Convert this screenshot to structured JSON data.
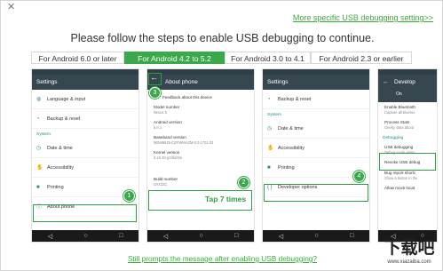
{
  "dialog": {
    "close_glyph": "✕",
    "top_link": "More specific USB debugging setting>>",
    "heading": "Please follow the steps to enable USB debugging to continue.",
    "bottom_link": "Still prompts the message after enabling USB debugging?"
  },
  "tabs": [
    {
      "label": "For Android 6.0 or later"
    },
    {
      "label": "For Android 4.2 to 5.2"
    },
    {
      "label": "For Android 3.0 to 4.1"
    },
    {
      "label": "For Android 2.3 or earlier"
    }
  ],
  "phone1": {
    "title": "Settings",
    "items": [
      {
        "label": "Language & input",
        "icon": "globe-icon"
      },
      {
        "label": "Backup & reset",
        "icon": "backup-icon"
      },
      {
        "label": "Date & time",
        "icon": "clock-icon"
      },
      {
        "label": "Accessibility",
        "icon": "accessibility-icon"
      },
      {
        "label": "Printing",
        "icon": "printer-icon"
      },
      {
        "label": "About phone",
        "icon": "info-icon"
      }
    ],
    "section": "System"
  },
  "phone2": {
    "title": "About phone",
    "feedback": "Feedback about this device",
    "details": [
      {
        "label": "Model number",
        "value": "Nexus 6"
      },
      {
        "label": "Android version",
        "value": "5.0.1"
      },
      {
        "label": "Baseband version",
        "value": "MDM9625-CEFWMAZM-2.0.1701.03"
      },
      {
        "label": "Kernel version",
        "value": "3.10.40-g15fa02e"
      },
      {
        "label": "Build number",
        "value": "LRX22C"
      }
    ],
    "tap_text": "Tap 7 times"
  },
  "phone3": {
    "title": "Settings",
    "items": [
      {
        "label": "Backup & reset",
        "icon": "backup-icon"
      },
      {
        "label": "Date & time",
        "icon": "clock-icon"
      },
      {
        "label": "Accessibility",
        "icon": "accessibility-icon"
      },
      {
        "label": "Printing",
        "icon": "printer-icon"
      },
      {
        "label": "Developer options",
        "icon": "developer-icon"
      }
    ],
    "section": "System"
  },
  "phone4": {
    "title": "Develop",
    "toggle": "On",
    "items": [
      {
        "label": "Enable Bluetooth",
        "sub": "Capture all bluetoo"
      },
      {
        "label": "Process Stats",
        "sub": "Geeky stats about"
      },
      {
        "label": "USB debugging",
        "sub": "Debug mode when"
      },
      {
        "label": "Revoke USB debug",
        "sub": ""
      },
      {
        "label": "Bug report shortc",
        "sub": "Show a button in the"
      },
      {
        "label": "Allow mock locat",
        "sub": ""
      }
    ],
    "section": "Debugging"
  },
  "badges": [
    "1",
    "2",
    "3",
    "4"
  ],
  "watermark": {
    "big": "下载吧",
    "small": "www.xiazaiba.com"
  },
  "colors": {
    "accent": "#3aa84b",
    "appbar": "#37474f"
  }
}
